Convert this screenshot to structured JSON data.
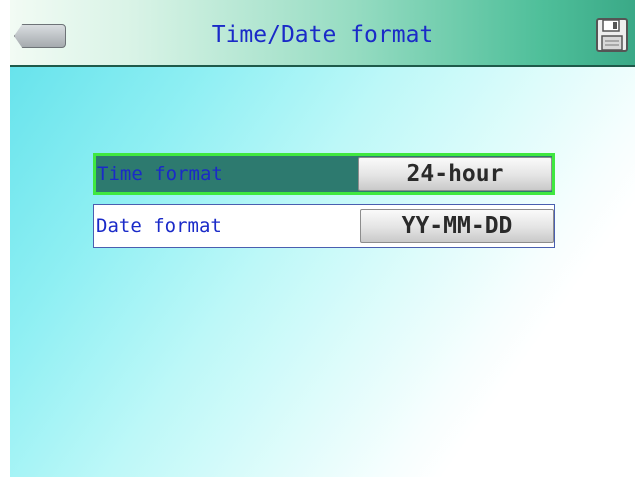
{
  "header": {
    "title": "Time/Date format",
    "back_icon": "back-arrow-icon",
    "save_icon": "floppy-disk-icon"
  },
  "settings": {
    "time_format": {
      "label": "Time format",
      "value": "24-hour",
      "selected": true
    },
    "date_format": {
      "label": "Date format",
      "value": "YY-MM-DD",
      "selected": false
    }
  },
  "colors": {
    "title_text": "#1a2ac8",
    "selected_row_bg": "#2d7a6f",
    "selected_row_border": "#3fe840",
    "header_accent": "#3aa987"
  }
}
